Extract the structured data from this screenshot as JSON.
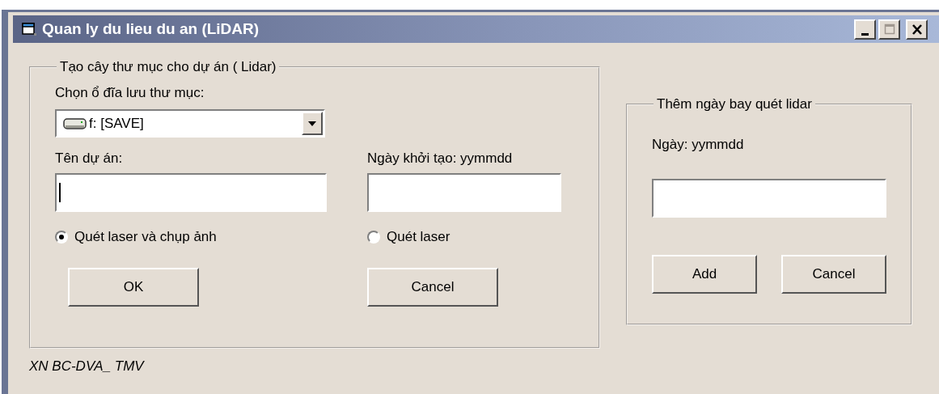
{
  "window": {
    "title": "Quan ly du lieu du an (LiDAR)",
    "caption_buttons": [
      {
        "kind": "minimize",
        "disabled": false
      },
      {
        "kind": "maximize",
        "disabled": true
      },
      {
        "kind": "close",
        "disabled": false
      }
    ]
  },
  "project_group": {
    "legend": "Tạo cây thư mục cho dự án ( Lidar)",
    "drive_label": "Chọn ổ đĩa lưu thư mục:",
    "drive_value": "f: [SAVE]",
    "fields": [
      {
        "label": "Tên dự án:",
        "focused": true
      },
      {
        "label": "Ngày khởi tạo: yymmdd",
        "focused": false
      }
    ],
    "options": [
      {
        "label": "Quét laser và chụp ảnh",
        "selected": true
      },
      {
        "label": "Quét laser",
        "selected": false
      }
    ],
    "buttons": [
      "OK",
      "Cancel"
    ]
  },
  "flight_group": {
    "legend": "Thêm ngày bay quét lidar",
    "label": "Ngày: yymmdd",
    "buttons": [
      "Add",
      "Cancel"
    ]
  },
  "status_text": "XN BC-DVA_ TMV"
}
